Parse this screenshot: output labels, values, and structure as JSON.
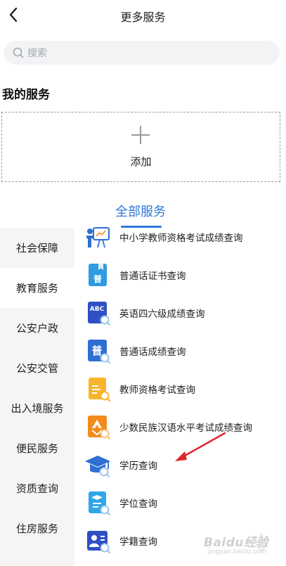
{
  "header": {
    "back_icon": "chevron-left-icon",
    "title": "更多服务"
  },
  "search": {
    "icon": "search-icon",
    "placeholder": "搜索"
  },
  "my_services": {
    "title": "我的服务",
    "add_icon": "plus-icon",
    "add_label": "添加"
  },
  "all_services": {
    "title": "全部服务",
    "accent_color": "#2f78d8"
  },
  "sidebar": {
    "items": [
      {
        "label": "社会保障",
        "active": false
      },
      {
        "label": "教育服务",
        "active": true
      },
      {
        "label": "公安户政",
        "active": false
      },
      {
        "label": "公安交管",
        "active": false
      },
      {
        "label": "出入境服务",
        "active": false
      },
      {
        "label": "便民服务",
        "active": false
      },
      {
        "label": "资质查询",
        "active": false
      },
      {
        "label": "住房服务",
        "active": false
      }
    ]
  },
  "services": [
    {
      "label": "中小学教师资格考试成绩查询",
      "icon": "teacher-board-icon"
    },
    {
      "label": "普通话证书查询",
      "icon": "putonghua-certificate-icon",
      "glyph": "普"
    },
    {
      "label": "英语四六级成绩查询",
      "icon": "abc-english-icon",
      "glyph": "ABC"
    },
    {
      "label": "普通话成绩查询",
      "icon": "putonghua-score-icon",
      "glyph": "普"
    },
    {
      "label": "教师资格考试查询",
      "icon": "teacher-exam-document-icon"
    },
    {
      "label": "少数民族汉语水平考试成绩查询",
      "icon": "minority-hsk-icon"
    },
    {
      "label": "学历查询",
      "icon": "graduation-cap-icon"
    },
    {
      "label": "学位查询",
      "icon": "degree-document-icon"
    },
    {
      "label": "学籍查询",
      "icon": "student-record-icon"
    }
  ],
  "annotation": {
    "arrow_icon": "red-arrow-icon",
    "arrow_color": "#e0262b"
  },
  "watermark": {
    "text": "Baidu经验",
    "url": "jingyan.baidu.com"
  }
}
